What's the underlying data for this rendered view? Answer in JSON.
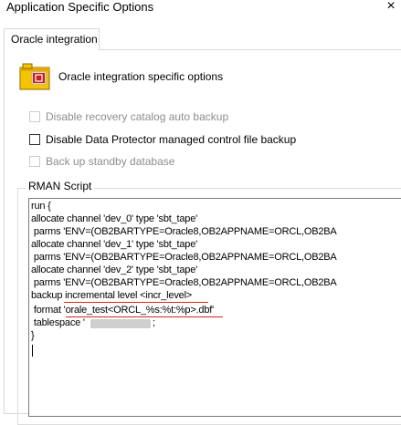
{
  "window": {
    "title": "Application Specific Options",
    "close_glyph": "×"
  },
  "tabs": [
    {
      "label": "Oracle integration",
      "selected": true
    }
  ],
  "section": {
    "icon": "oracle-integration-icon",
    "heading": "Oracle integration specific options"
  },
  "options": [
    {
      "label": "Disable recovery catalog auto backup",
      "checked": false,
      "enabled": false
    },
    {
      "label": "Disable Data Protector managed control file backup",
      "checked": false,
      "enabled": true
    },
    {
      "label": "Back up standby database",
      "checked": false,
      "enabled": false
    }
  ],
  "rman": {
    "group_label": "RMAN Script",
    "lines": [
      "run {",
      "allocate channel 'dev_0' type 'sbt_tape'",
      " parms 'ENV=(OB2BARTYPE=Oracle8,OB2APPNAME=ORCL,OB2BA",
      "allocate channel 'dev_1' type 'sbt_tape'",
      " parms 'ENV=(OB2BARTYPE=Oracle8,OB2APPNAME=ORCL,OB2BA",
      "allocate channel 'dev_2' type 'sbt_tape'",
      " parms 'ENV=(OB2BARTYPE=Oracle8,OB2APPNAME=ORCL,OB2BA",
      "backup incremental level <incr_level>",
      " format 'orale_test<ORCL_%s:%t:%p>.dbf'",
      " tablespace '",
      "}"
    ],
    "line_9_suffix": ";",
    "highlight_color": "#d9251d"
  }
}
